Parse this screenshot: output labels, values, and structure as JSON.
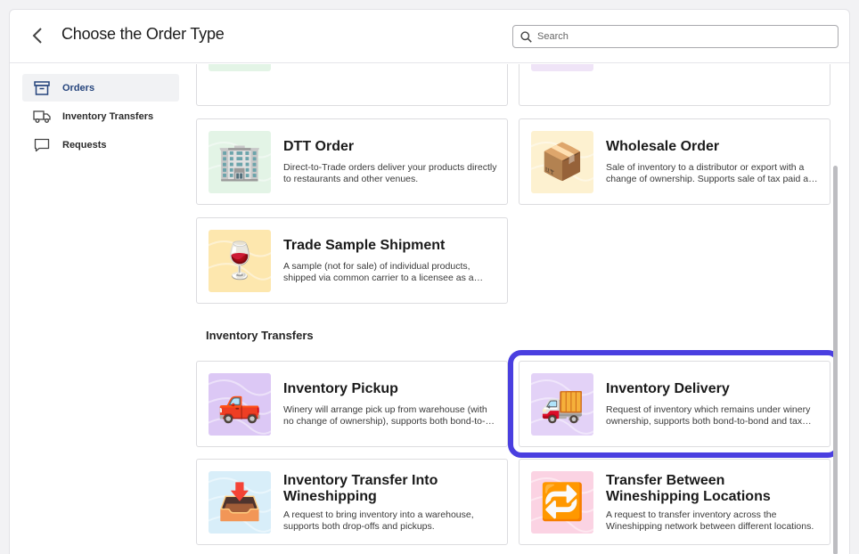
{
  "header": {
    "title": "Choose the Order Type",
    "search_placeholder": "Search"
  },
  "sidebar": {
    "items": [
      {
        "label": "Orders",
        "icon": "archive-box-icon",
        "active": true
      },
      {
        "label": "Inventory Transfers",
        "icon": "truck-icon",
        "active": false
      },
      {
        "label": "Requests",
        "icon": "chat-bubble-icon",
        "active": false
      }
    ]
  },
  "orders": {
    "cards": [
      {
        "title": "DTT Order",
        "description": "Direct-to-Trade orders deliver your products directly to restaurants and other venues.",
        "icon": "office-building-icon",
        "bg": "#e3f4e6"
      },
      {
        "title": "Wholesale Order",
        "description": "Sale of inventory to a distributor or export with a change of ownership. Supports sale of tax paid and in-bond inventory.",
        "icon": "packages-icon",
        "bg": "#fdf1d0"
      },
      {
        "title": "Trade Sample Shipment",
        "description": "A sample (not for sale) of individual products, shipped via common carrier to a licensee as a trade sample.",
        "icon": "wine-glass-icon",
        "bg": "#fde7ae"
      }
    ]
  },
  "inventory_transfers": {
    "section_title": "Inventory Transfers",
    "cards": [
      {
        "title": "Inventory Pickup",
        "description": "Winery will arrange pick up from warehouse (with no change of ownership), supports both bond-to-bond and tax paid.",
        "icon": "pickup-truck-icon",
        "bg": "#dcc8f5"
      },
      {
        "title": "Inventory Delivery",
        "description": "Request of inventory which remains under winery ownership, supports both bond-to-bond and tax paid.",
        "icon": "delivery-truck-icon",
        "bg": "#e3d2f7"
      },
      {
        "title": "Inventory Transfer Into Wineshipping",
        "description": "A request to bring inventory into a warehouse, supports both drop-offs and pickups.",
        "icon": "inbox-tray-icon",
        "bg": "#d8eef9"
      },
      {
        "title": "Transfer Between Wineshipping Locations",
        "description": "A request to transfer inventory across the Wineshipping network between different locations.",
        "icon": "repeat-arrows-icon",
        "bg": "#fbd3e3"
      }
    ]
  },
  "colors": {
    "accent": "#26457d",
    "highlight": "#4a3fe0"
  }
}
